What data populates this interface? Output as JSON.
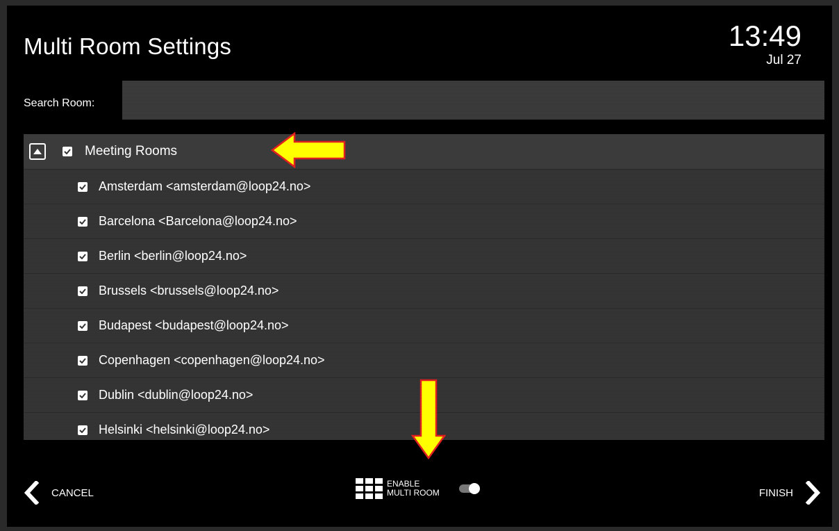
{
  "header": {
    "title": "Multi Room Settings",
    "time": "13:49",
    "date": "Jul 27"
  },
  "search": {
    "label": "Search Room:",
    "value": "",
    "placeholder": ""
  },
  "group": {
    "label": "Meeting Rooms",
    "checked": true,
    "expanded": true
  },
  "rooms": [
    {
      "label": "Amsterdam <amsterdam@loop24.no>",
      "checked": true
    },
    {
      "label": "Barcelona <Barcelona@loop24.no>",
      "checked": true
    },
    {
      "label": "Berlin <berlin@loop24.no>",
      "checked": true
    },
    {
      "label": "Brussels <brussels@loop24.no>",
      "checked": true
    },
    {
      "label": "Budapest <budapest@loop24.no>",
      "checked": true
    },
    {
      "label": "Copenhagen <copenhagen@loop24.no>",
      "checked": true
    },
    {
      "label": "Dublin <dublin@loop24.no>",
      "checked": true
    },
    {
      "label": "Helsinki <helsinki@loop24.no>",
      "checked": true
    }
  ],
  "footer": {
    "cancel_label": "CANCEL",
    "multi_room_label": "ENABLE MULTI ROOM",
    "multi_room_enabled": true,
    "finish_label": "FINISH"
  },
  "colors": {
    "background": "#000000",
    "list_row": "#333333",
    "annotation_arrow_fill": "#ffff00",
    "annotation_arrow_stroke": "#e02020"
  },
  "icons": {
    "collapse": "chevron-up-icon",
    "checkbox": "checkbox-checked-icon",
    "cancel": "chevron-left-icon",
    "finish": "chevron-right-icon",
    "multi_room": "grid-icon"
  }
}
